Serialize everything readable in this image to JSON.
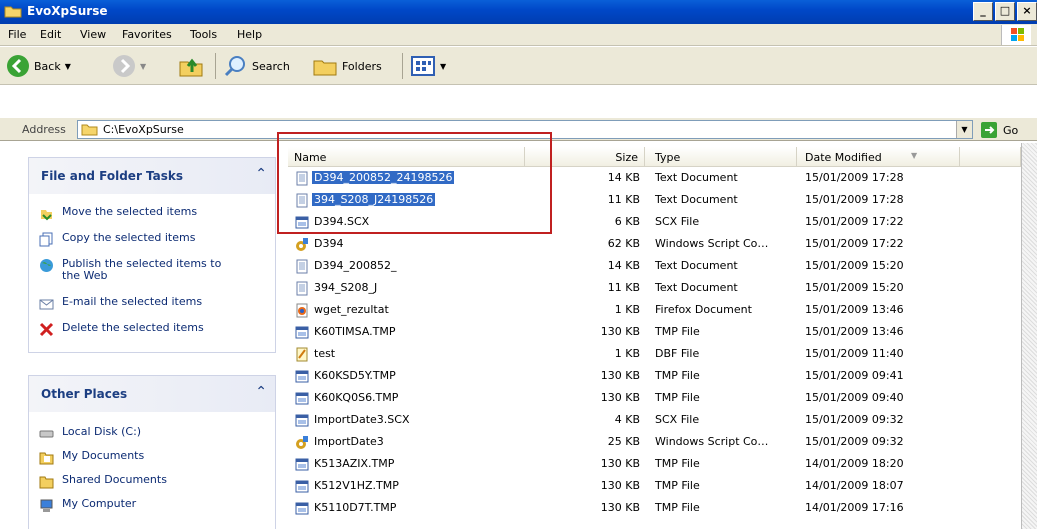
{
  "window": {
    "title": "EvoXpSurse"
  },
  "menu": [
    "File",
    "Edit",
    "View",
    "Favorites",
    "Tools",
    "Help"
  ],
  "toolbar": {
    "back": "Back",
    "search": "Search",
    "folders": "Folders"
  },
  "address": {
    "label": "Address",
    "value": "C:\\EvoXpSurse",
    "go": "Go"
  },
  "file_tasks": {
    "title": "File and Folder Tasks",
    "items": [
      "Move the selected items",
      "Copy the selected items",
      "Publish the selected items to the Web",
      "E-mail the selected items",
      "Delete the selected items"
    ]
  },
  "other_places": {
    "title": "Other Places",
    "items": [
      "Local Disk (C:)",
      "My Documents",
      "Shared Documents",
      "My Computer"
    ]
  },
  "columns": {
    "name": "Name",
    "size": "Size",
    "type": "Type",
    "date": "Date Modified"
  },
  "files": [
    {
      "name": "D394_200852_24198526",
      "size": "14 KB",
      "type": "Text Document",
      "date": "15/01/2009 17:28",
      "icon": "text-doc",
      "selected": true
    },
    {
      "name": "394_S208_J24198526",
      "size": "11 KB",
      "type": "Text Document",
      "date": "15/01/2009 17:28",
      "icon": "text-doc",
      "selected": true
    },
    {
      "name": "D394.SCX",
      "size": "6 KB",
      "type": "SCX File",
      "date": "15/01/2009 17:22",
      "icon": "app-file",
      "selected": false
    },
    {
      "name": "D394",
      "size": "62 KB",
      "type": "Windows Script Co…",
      "date": "15/01/2009 17:22",
      "icon": "script",
      "selected": false
    },
    {
      "name": "D394_200852_",
      "size": "14 KB",
      "type": "Text Document",
      "date": "15/01/2009 15:20",
      "icon": "text-doc",
      "selected": false
    },
    {
      "name": "394_S208_J",
      "size": "11 KB",
      "type": "Text Document",
      "date": "15/01/2009 15:20",
      "icon": "text-doc",
      "selected": false
    },
    {
      "name": "wget_rezultat",
      "size": "1 KB",
      "type": "Firefox Document",
      "date": "15/01/2009 13:46",
      "icon": "firefox",
      "selected": false
    },
    {
      "name": "K60TIMSA.TMP",
      "size": "130 KB",
      "type": "TMP File",
      "date": "15/01/2009 13:46",
      "icon": "app-file",
      "selected": false
    },
    {
      "name": "test",
      "size": "1 KB",
      "type": "DBF File",
      "date": "15/01/2009 11:40",
      "icon": "dbf",
      "selected": false
    },
    {
      "name": "K60KSD5Y.TMP",
      "size": "130 KB",
      "type": "TMP File",
      "date": "15/01/2009 09:41",
      "icon": "app-file",
      "selected": false
    },
    {
      "name": "K60KQ0S6.TMP",
      "size": "130 KB",
      "type": "TMP File",
      "date": "15/01/2009 09:40",
      "icon": "app-file",
      "selected": false
    },
    {
      "name": "ImportDate3.SCX",
      "size": "4 KB",
      "type": "SCX File",
      "date": "15/01/2009 09:32",
      "icon": "app-file",
      "selected": false
    },
    {
      "name": "ImportDate3",
      "size": "25 KB",
      "type": "Windows Script Co…",
      "date": "15/01/2009 09:32",
      "icon": "script",
      "selected": false
    },
    {
      "name": "K513AZIX.TMP",
      "size": "130 KB",
      "type": "TMP File",
      "date": "14/01/2009 18:20",
      "icon": "app-file",
      "selected": false
    },
    {
      "name": "K512V1HZ.TMP",
      "size": "130 KB",
      "type": "TMP File",
      "date": "14/01/2009 18:07",
      "icon": "app-file",
      "selected": false
    },
    {
      "name": "K5110D7T.TMP",
      "size": "130 KB",
      "type": "TMP File",
      "date": "14/01/2009 17:16",
      "icon": "app-file",
      "selected": false
    }
  ]
}
